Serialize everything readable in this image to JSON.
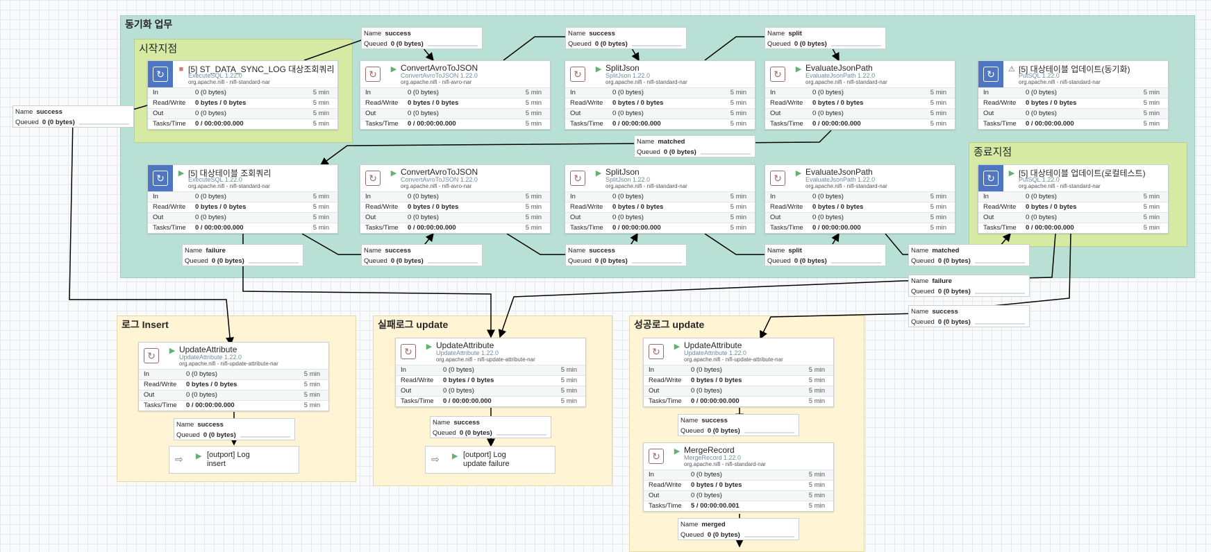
{
  "groups": {
    "sync_task": "동기화 업무",
    "start_point": "시작지점",
    "end_point": "종료지점",
    "log_insert": "로그 Insert",
    "fail_update": "실패로그 update",
    "success_update": "성공로그 update"
  },
  "stat_labels": {
    "in": "In",
    "rw": "Read/Write",
    "out": "Out",
    "tasks": "Tasks/Time"
  },
  "conn_labels": {
    "name": "Name",
    "queued": "Queued"
  },
  "processors": [
    {
      "name": "[5] ST_DATA_SYNC_LOG 대상조회쿼리",
      "type": "ExecuteSQL 1.22.0",
      "bundle": "org.apache.nifi - nifi-standard-nar",
      "in": "0 (0 bytes)",
      "rw": "0 bytes / 0 bytes",
      "out": "0 (0 bytes)",
      "tasks": "0 / 00:00:00.000",
      "time": "5 min"
    },
    {
      "name": "ConvertAvroToJSON",
      "type": "ConvertAvroToJSON 1.22.0",
      "bundle": "org.apache.nifi - nifi-avro-nar",
      "in": "0 (0 bytes)",
      "rw": "0 bytes / 0 bytes",
      "out": "0 (0 bytes)",
      "tasks": "0 / 00:00:00.000",
      "time": "5 min"
    },
    {
      "name": "SplitJson",
      "type": "SplitJson 1.22.0",
      "bundle": "org.apache.nifi - nifi-standard-nar",
      "in": "0 (0 bytes)",
      "rw": "0 bytes / 0 bytes",
      "out": "0 (0 bytes)",
      "tasks": "0 / 00:00:00.000",
      "time": "5 min"
    },
    {
      "name": "EvaluateJsonPath",
      "type": "EvaluateJsonPath 1.22.0",
      "bundle": "org.apache.nifi - nifi-standard-nar",
      "in": "0 (0 bytes)",
      "rw": "0 bytes / 0 bytes",
      "out": "0 (0 bytes)",
      "tasks": "0 / 00:00:00.000",
      "time": "5 min"
    },
    {
      "name": "[5] 대상테이블 업데이트(동기화)",
      "type": "PutSQL 1.22.0",
      "bundle": "org.apache.nifi - nifi-standard-nar",
      "in": "0 (0 bytes)",
      "rw": "0 bytes / 0 bytes",
      "out": "0 (0 bytes)",
      "tasks": "0 / 00:00:00.000",
      "time": "5 min"
    },
    {
      "name": "[5] 대상테이블 조회쿼리",
      "type": "ExecuteSQL 1.22.0",
      "bundle": "org.apache.nifi - nifi-standard-nar",
      "in": "0 (0 bytes)",
      "rw": "0 bytes / 0 bytes",
      "out": "0 (0 bytes)",
      "tasks": "0 / 00:00:00.000",
      "time": "5 min"
    },
    {
      "name": "ConvertAvroToJSON",
      "type": "ConvertAvroToJSON 1.22.0",
      "bundle": "org.apache.nifi - nifi-avro-nar",
      "in": "0 (0 bytes)",
      "rw": "0 bytes / 0 bytes",
      "out": "0 (0 bytes)",
      "tasks": "0 / 00:00:00.000",
      "time": "5 min"
    },
    {
      "name": "SplitJson",
      "type": "SplitJson 1.22.0",
      "bundle": "org.apache.nifi - nifi-standard-nar",
      "in": "0 (0 bytes)",
      "rw": "0 bytes / 0 bytes",
      "out": "0 (0 bytes)",
      "tasks": "0 / 00:00:00.000",
      "time": "5 min"
    },
    {
      "name": "EvaluateJsonPath",
      "type": "EvaluateJsonPath 1.22.0",
      "bundle": "org.apache.nifi - nifi-standard-nar",
      "in": "0 (0 bytes)",
      "rw": "0 bytes / 0 bytes",
      "out": "0 (0 bytes)",
      "tasks": "0 / 00:00:00.000",
      "time": "5 min"
    },
    {
      "name": "[5] 대상테이블 업데이트(로컬테스트)",
      "type": "PutSQL 1.22.0",
      "bundle": "org.apache.nifi - nifi-standard-nar",
      "in": "0 (0 bytes)",
      "rw": "0 bytes / 0 bytes",
      "out": "0 (0 bytes)",
      "tasks": "0 / 00:00:00.000",
      "time": "5 min"
    },
    {
      "name": "UpdateAttribute",
      "type": "UpdateAttribute 1.22.0",
      "bundle": "org.apache.nifi - nifi-update-attribute-nar",
      "in": "0 (0 bytes)",
      "rw": "0 bytes / 0 bytes",
      "out": "0 (0 bytes)",
      "tasks": "0 / 00:00:00.000",
      "time": "5 min"
    },
    {
      "name": "UpdateAttribute",
      "type": "UpdateAttribute 1.22.0",
      "bundle": "org.apache.nifi - nifi-update-attribute-nar",
      "in": "0 (0 bytes)",
      "rw": "0 bytes / 0 bytes",
      "out": "0 (0 bytes)",
      "tasks": "0 / 00:00:00.000",
      "time": "5 min"
    },
    {
      "name": "UpdateAttribute",
      "type": "UpdateAttribute 1.22.0",
      "bundle": "org.apache.nifi - nifi-update-attribute-nar",
      "in": "0 (0 bytes)",
      "rw": "0 bytes / 0 bytes",
      "out": "0 (0 bytes)",
      "tasks": "0 / 00:00:00.000",
      "time": "5 min"
    },
    {
      "name": "MergeRecord",
      "type": "MergeRecord 1.22.0",
      "bundle": "org.apache.nifi - nifi-standard-nar",
      "in": "0 (0 bytes)",
      "rw": "0 bytes / 0 bytes",
      "out": "0 (0 bytes)",
      "tasks": "5 / 00:00:00.001",
      "time": "5 min"
    }
  ],
  "connections": [
    {
      "name": "success",
      "queued": "0 (0 bytes)"
    },
    {
      "name": "success",
      "queued": "0 (0 bytes)"
    },
    {
      "name": "success",
      "queued": "0 (0 bytes)"
    },
    {
      "name": "split",
      "queued": "0 (0 bytes)"
    },
    {
      "name": "matched",
      "queued": "0 (0 bytes)"
    },
    {
      "name": "failure",
      "queued": "0 (0 bytes)"
    },
    {
      "name": "success",
      "queued": "0 (0 bytes)"
    },
    {
      "name": "success",
      "queued": "0 (0 bytes)"
    },
    {
      "name": "split",
      "queued": "0 (0 bytes)"
    },
    {
      "name": "matched",
      "queued": "0 (0 bytes)"
    },
    {
      "name": "failure",
      "queued": "0 (0 bytes)"
    },
    {
      "name": "success",
      "queued": "0 (0 bytes)"
    },
    {
      "name": "success",
      "queued": "0 (0 bytes)"
    },
    {
      "name": "success",
      "queued": "0 (0 bytes)"
    },
    {
      "name": "success",
      "queued": "0 (0 bytes)"
    },
    {
      "name": "merged",
      "queued": "0 (0 bytes)"
    }
  ],
  "ports": [
    {
      "label": "[outport] Log\ninsert"
    },
    {
      "label": "[outport] Log\nupdate failure"
    }
  ],
  "colors": {
    "sync_group": "#b9e0d5",
    "start_end_group": "#d7eaa4",
    "log_group": "#fff5d4",
    "processor_icon": "#4f77c1",
    "run_state": "#63b26d",
    "stop_state": "#d27b7b"
  },
  "icons": {
    "processor": "processor-icon",
    "state_running": "play-icon",
    "state_stopped": "stop-icon",
    "state_invalid": "invalid-icon",
    "output_port": "output-port-icon"
  }
}
